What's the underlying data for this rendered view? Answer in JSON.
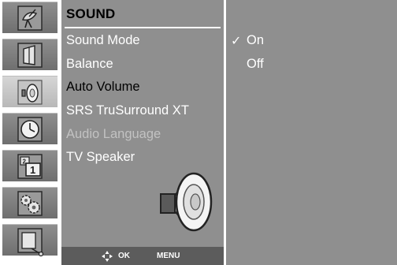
{
  "side_menu": [
    {
      "name": "Setup"
    },
    {
      "name": "Picture Mode"
    },
    {
      "name": "Sound",
      "active": true
    },
    {
      "name": "Time"
    },
    {
      "name": "Option"
    },
    {
      "name": "Lock"
    },
    {
      "name": "Input"
    }
  ],
  "menu": {
    "title": "SOUND",
    "items": [
      {
        "label": "Sound Mode"
      },
      {
        "label": "Balance"
      },
      {
        "label": "Auto Volume",
        "state": "selected"
      },
      {
        "label": "SRS TruSurround XT"
      },
      {
        "label": "Audio Language",
        "state": "disabled"
      },
      {
        "label": "TV Speaker"
      }
    ]
  },
  "options": {
    "check_mark": "✓",
    "items": [
      {
        "label": "On",
        "checked": true
      },
      {
        "label": "Off",
        "checked": false
      }
    ]
  },
  "nav_bar": {
    "ok_label": "OK",
    "menu_label": "MENU"
  },
  "colors": {
    "panel_bg": "#8f8f8f",
    "active_tile": "#c8c8c8",
    "text": "#ffffff",
    "selected_text": "#000000",
    "disabled_text": "#c2c2c2"
  }
}
